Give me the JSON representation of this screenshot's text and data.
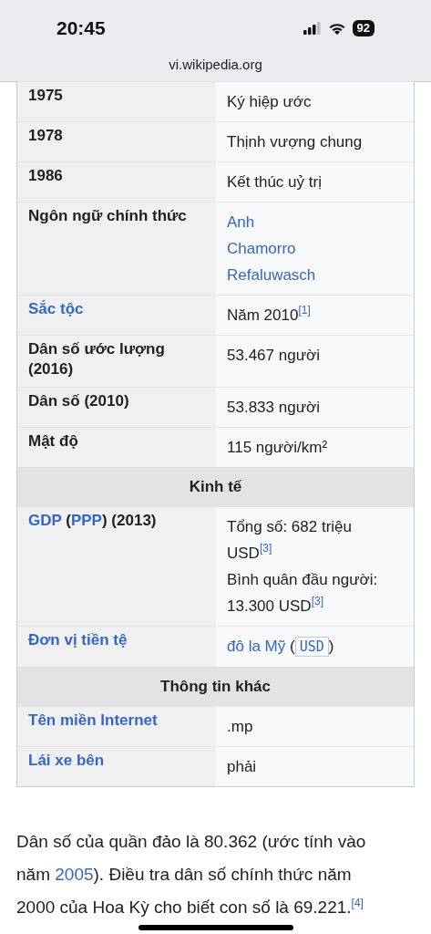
{
  "status_bar": {
    "time": "20:45",
    "battery": "92"
  },
  "address_bar": {
    "url": "vi.wikipedia.org"
  },
  "infobox": {
    "rows": [
      {
        "kind": "data",
        "label": [
          {
            "text": "1975",
            "link": false
          }
        ],
        "value": [
          [
            {
              "text": "Ký hiệp ước",
              "kind": "plain"
            }
          ]
        ]
      },
      {
        "kind": "data",
        "label": [
          {
            "text": "1978",
            "link": false
          }
        ],
        "value": [
          [
            {
              "text": "Thịnh vượng chung",
              "kind": "plain"
            }
          ]
        ]
      },
      {
        "kind": "data",
        "label": [
          {
            "text": "1986",
            "link": false
          }
        ],
        "value": [
          [
            {
              "text": "Kết thúc uỷ trị",
              "kind": "plain"
            }
          ]
        ]
      },
      {
        "kind": "data",
        "label": [
          {
            "text": "Ngôn ngữ chính thức",
            "link": false
          }
        ],
        "value": [
          [
            {
              "text": "Anh",
              "kind": "link"
            }
          ],
          [
            {
              "text": "Chamorro",
              "kind": "link"
            }
          ],
          [
            {
              "text": "Refaluwasch",
              "kind": "link"
            }
          ]
        ]
      },
      {
        "kind": "data",
        "label": [
          {
            "text": "Sắc tộc",
            "link": true
          }
        ],
        "value": [
          [
            {
              "text": "Năm 2010",
              "kind": "plain"
            },
            {
              "text": "[1]",
              "kind": "ref"
            }
          ]
        ]
      },
      {
        "kind": "data",
        "label": [
          {
            "text": "Dân số ước lượng (2016)",
            "link": false
          }
        ],
        "value": [
          [
            {
              "text": "53.467 người",
              "kind": "plain"
            }
          ]
        ]
      },
      {
        "kind": "data",
        "label": [
          {
            "text": "Dân số (2010)",
            "link": false
          }
        ],
        "value": [
          [
            {
              "text": "53.833 người",
              "kind": "plain"
            }
          ]
        ]
      },
      {
        "kind": "data",
        "label": [
          {
            "text": "Mật độ",
            "link": false
          }
        ],
        "value": [
          [
            {
              "text": "115 người/km²",
              "kind": "plain"
            }
          ]
        ]
      },
      {
        "kind": "header",
        "title": "Kinh tế"
      },
      {
        "kind": "data",
        "label": [
          {
            "text": "GDP",
            "link": true
          },
          {
            "text": " (",
            "link": false
          },
          {
            "text": "PPP",
            "link": true
          },
          {
            "text": ") (2013)",
            "link": false
          }
        ],
        "value": [
          [
            {
              "text": "Tổng số: 682 triệu",
              "kind": "plain"
            }
          ],
          [
            {
              "text": "USD",
              "kind": "plain"
            },
            {
              "text": "[3]",
              "kind": "ref"
            }
          ],
          [
            {
              "text": "Bình quân đầu người:",
              "kind": "plain"
            }
          ],
          [
            {
              "text": "13.300 USD",
              "kind": "plain"
            },
            {
              "text": "[3]",
              "kind": "ref"
            }
          ]
        ]
      },
      {
        "kind": "data",
        "label": [
          {
            "text": "Đơn vị tiền tệ",
            "link": true
          }
        ],
        "value": [
          [
            {
              "text": "đô la Mỹ",
              "kind": "link"
            },
            {
              "text": " (",
              "kind": "plain"
            },
            {
              "text": "USD",
              "kind": "code"
            },
            {
              "text": ")",
              "kind": "plain"
            }
          ]
        ]
      },
      {
        "kind": "header",
        "title": "Thông tin khác"
      },
      {
        "kind": "data",
        "label": [
          {
            "text": "Tên miền Internet",
            "link": true
          }
        ],
        "value": [
          [
            {
              "text": ".mp",
              "kind": "plain"
            }
          ]
        ]
      },
      {
        "kind": "data",
        "label": [
          {
            "text": "Lái xe bên",
            "link": true
          }
        ],
        "value": [
          [
            {
              "text": "phải",
              "kind": "plain"
            }
          ]
        ]
      }
    ]
  },
  "paragraphs": [
    [
      {
        "text": "Dân số của quần đảo là 80.362 (ước tính vào năm ",
        "kind": "plain"
      },
      {
        "text": "2005",
        "kind": "link"
      },
      {
        "text": "). Điều tra dân số chính thức năm 2000 của Hoa Kỳ cho biết con số là 69.221.",
        "kind": "plain"
      },
      {
        "text": "[4]",
        "kind": "ref"
      }
    ]
  ]
}
